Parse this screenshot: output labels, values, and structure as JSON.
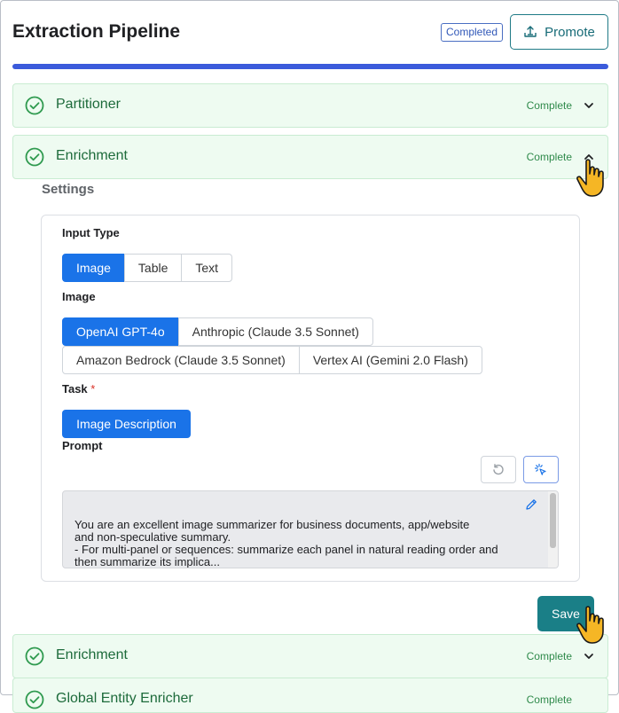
{
  "header": {
    "title": "Extraction Pipeline",
    "status_badge": "Completed",
    "promote_label": "Promote"
  },
  "progress": {
    "fraction": 1.0
  },
  "colors": {
    "accent": "#1a73e8",
    "progress": "#3b5bdb",
    "primary_action": "#1a7f87",
    "complete_green": "#2f8a4b"
  },
  "stages": [
    {
      "name": "Partitioner",
      "status": "Complete",
      "expanded": false
    },
    {
      "name": "Enrichment",
      "status": "Complete",
      "expanded": true
    },
    {
      "name": "Enrichment",
      "status": "Complete",
      "expanded": false
    },
    {
      "name": "Global Entity Enricher",
      "status": "Complete",
      "expanded": false
    }
  ],
  "settings": {
    "title": "Settings",
    "input_type": {
      "label": "Input Type",
      "options": [
        "Image",
        "Table",
        "Text"
      ],
      "selected": "Image"
    },
    "image": {
      "label": "Image",
      "options": [
        "OpenAI GPT-4o",
        "Anthropic (Claude 3.5 Sonnet)",
        "Amazon Bedrock (Claude 3.5 Sonnet)",
        "Vertex AI (Gemini 2.0 Flash)"
      ],
      "selected": "OpenAI GPT-4o"
    },
    "task": {
      "label": "Task",
      "required_marker": "*",
      "value": "Image Description"
    },
    "prompt": {
      "label": "Prompt",
      "lines": [
        "You are an excellent image summarizer for business documents, app/website",
        "and non-speculative summary.",
        "- For multi-panel or sequences: summarize each panel in natural reading order and",
        "then summarize its implica..."
      ]
    },
    "save_label": "Save"
  },
  "icons": {
    "promote": "upload-icon",
    "stage_status": "check-circle-icon",
    "collapse": "chevron-up-icon",
    "expand": "chevron-down-icon",
    "reset": "reset-icon",
    "magic": "sparkle-cursor-icon",
    "edit": "pencil-icon",
    "pointer": "hand-pointer-icon"
  }
}
